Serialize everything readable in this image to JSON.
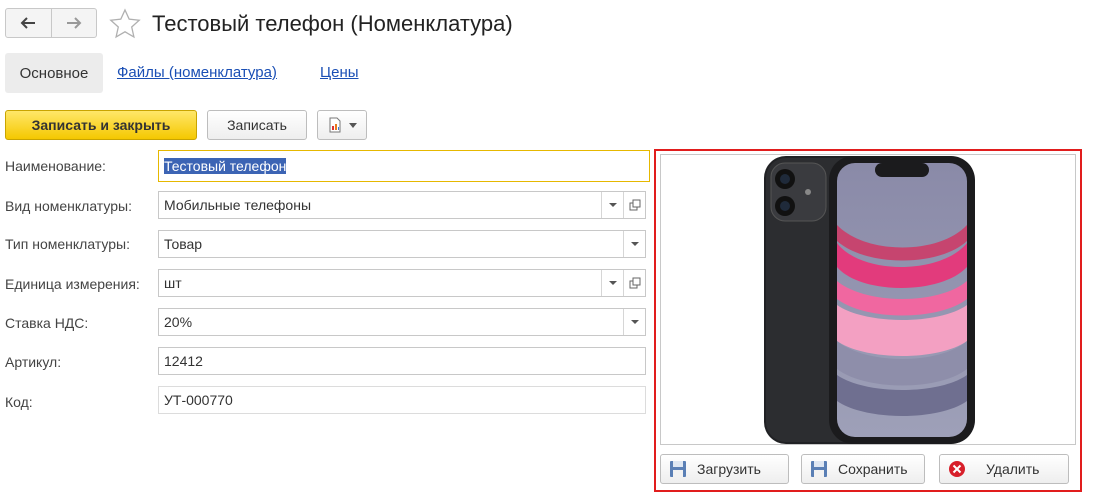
{
  "window": {
    "title": "Тестовый телефон (Номенклатура)"
  },
  "tabs": [
    {
      "label": "Основное",
      "active": true
    },
    {
      "label": "Файлы (номенклатура)",
      "active": false
    },
    {
      "label": "Цены",
      "active": false
    }
  ],
  "toolbar": {
    "save_close_label": "Записать и закрыть",
    "save_label": "Записать"
  },
  "form": {
    "name": {
      "label": "Наименование:",
      "value": "Тестовый телефон"
    },
    "kind": {
      "label": "Вид номенклатуры:",
      "value": "Мобильные телефоны"
    },
    "type": {
      "label": "Тип номенклатуры:",
      "value": "Товар"
    },
    "unit": {
      "label": "Единица измерения:",
      "value": "шт"
    },
    "vat": {
      "label": "Ставка НДС:",
      "value": "20%"
    },
    "article": {
      "label": "Артикул:",
      "value": "12412"
    },
    "code": {
      "label": "Код:",
      "value": "УТ-000770"
    }
  },
  "image_panel": {
    "upload_label": "Загрузить",
    "save_label": "Сохранить",
    "delete_label": "Удалить"
  },
  "icons": {
    "back": "arrow-left-icon",
    "forward": "arrow-right-icon",
    "favorite": "star-icon",
    "report": "report-icon",
    "open": "open-icon",
    "upload": "floppy-icon",
    "save": "floppy-icon",
    "delete": "delete-icon"
  },
  "colors": {
    "primary_button": "#f5c800",
    "link": "#1a4fb5",
    "highlight_border": "#e11d1d",
    "focus_border": "#e6b800",
    "selection": "#3c64b4"
  }
}
